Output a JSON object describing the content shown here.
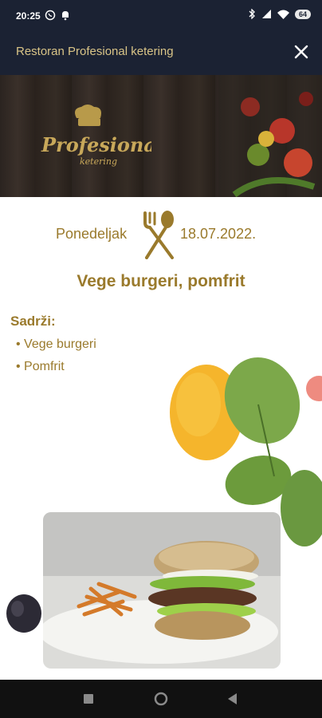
{
  "status": {
    "time": "20:25",
    "battery": "64",
    "left_icons": [
      "viber-icon",
      "notification-bell-icon"
    ],
    "right_icons": [
      "bluetooth-icon",
      "signal-icon",
      "wifi-icon",
      "battery-icon"
    ]
  },
  "app_bar": {
    "title": "Restoran Profesional ketering",
    "close_icon": "close-icon"
  },
  "hero": {
    "logo_text": "Profesional",
    "logo_subtext": "ketering"
  },
  "menu": {
    "day": "Ponedeljak",
    "date": "18.07.2022.",
    "meal": "Vege burgeri, pomfrit",
    "contains_label": "Sadrži:",
    "items": [
      "Vege burgeri",
      "Pomfrit"
    ]
  },
  "nav": {
    "buttons": [
      "recents-square-icon",
      "home-circle-icon",
      "back-triangle-icon"
    ]
  },
  "colors": {
    "accent_gold": "#9a7a2c",
    "bar_dark": "#1b2233",
    "title_gold": "#d9c487"
  }
}
